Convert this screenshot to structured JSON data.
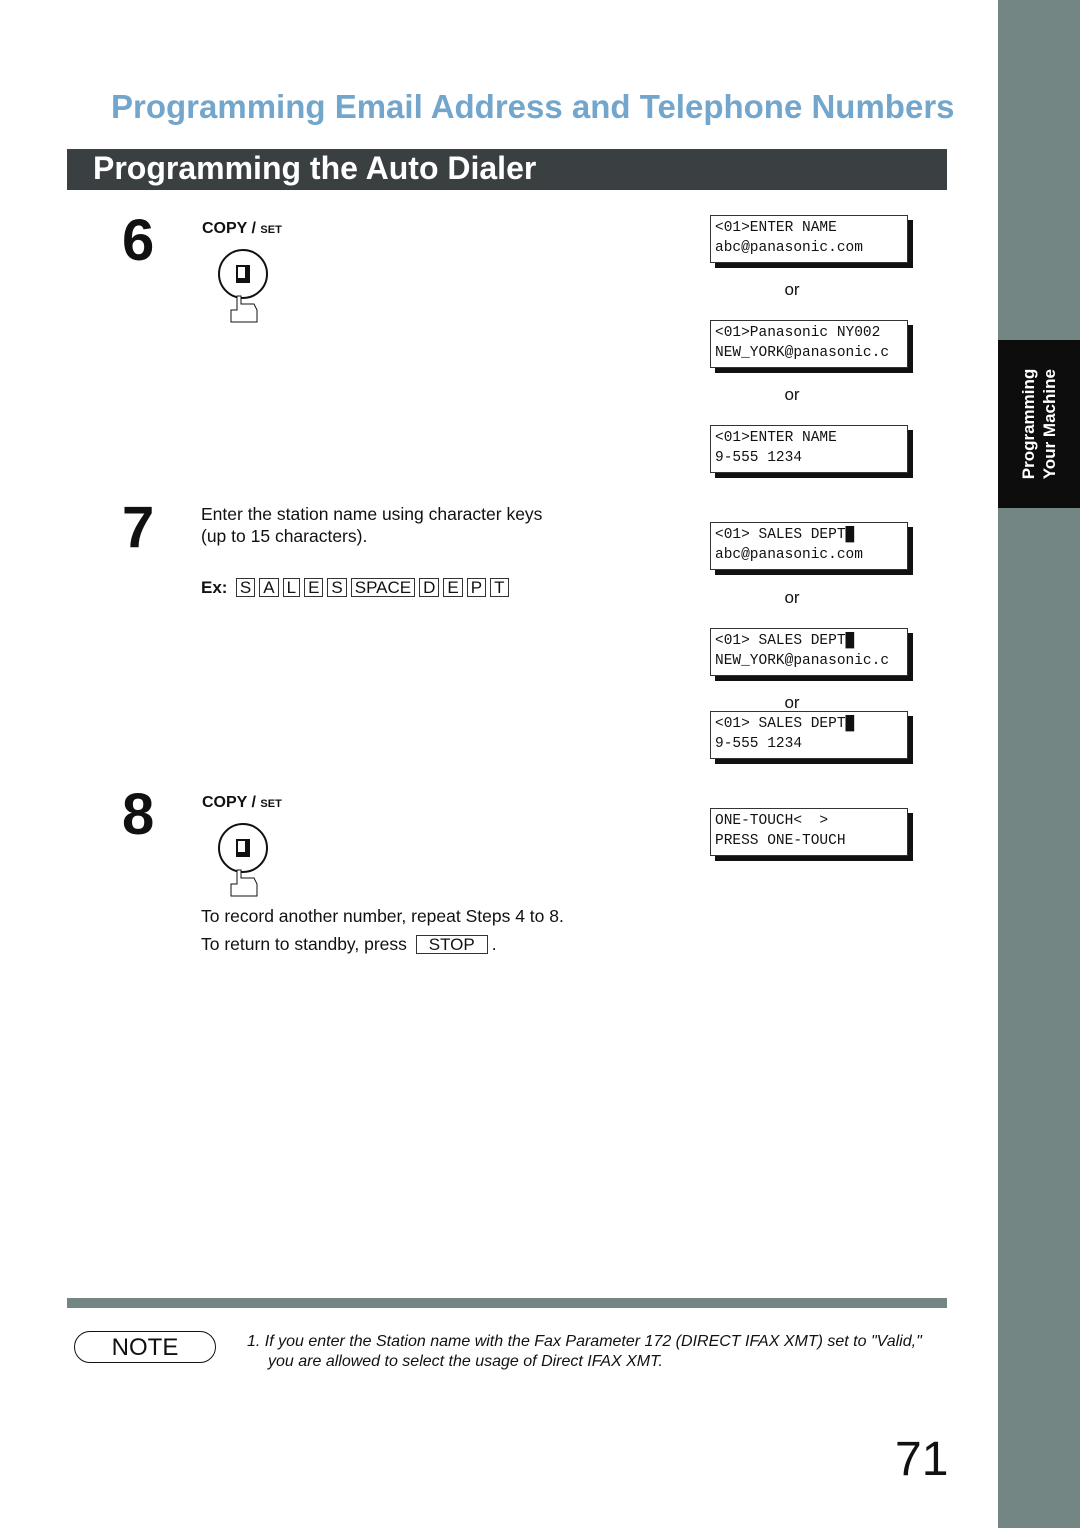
{
  "section_title": "Programming Email Address and Telephone Numbers",
  "header": "Programming the Auto Dialer",
  "side_tab": {
    "line1": "Programming",
    "line2": "Your Machine"
  },
  "steps": [
    {
      "number": "6",
      "key_label": "COPY /",
      "key_label_small": "SET"
    },
    {
      "number": "7",
      "text1": "Enter the station name using character keys",
      "text2": "(up to 15 characters).",
      "ex_label": "Ex:",
      "keys": [
        "S",
        "A",
        "L",
        "E",
        "S",
        "SPACE",
        "D",
        "E",
        "P",
        "T"
      ]
    },
    {
      "number": "8",
      "key_label": "COPY /",
      "key_label_small": "SET",
      "text1": "To record another number, repeat Steps 4 to 8.",
      "text2": "To return to standby, press",
      "stop_key": "STOP",
      "text2_end": "."
    }
  ],
  "displays": [
    {
      "line1": "<01>ENTER NAME",
      "line2": "abc@panasonic.com"
    },
    {
      "line1": "<01>Panasonic NY002",
      "line2": "NEW_YORK@panasonic.c"
    },
    {
      "line1": "<01>ENTER NAME",
      "line2": "9-555 1234"
    },
    {
      "line1": "<01> SALES DEPT█",
      "line2": "abc@panasonic.com"
    },
    {
      "line1": "<01> SALES DEPT█",
      "line2": "NEW_YORK@panasonic.c"
    },
    {
      "line1": "<01> SALES DEPT█",
      "line2": "9-555 1234"
    },
    {
      "line1": "ONE-TOUCH<  >",
      "line2": "PRESS ONE-TOUCH"
    }
  ],
  "or_label": "or",
  "note": {
    "badge": "NOTE",
    "line1": "1.  If you enter the Station name with the Fax Parameter 172 (DIRECT IFAX XMT) set to \"Valid,\"",
    "line2": "you are allowed to select the usage of Direct IFAX XMT."
  },
  "page_number": "71",
  "colors": {
    "title": "#73a6cc",
    "header_bg": "#3a3f42",
    "sidebar": "#748684",
    "tab": "#0d0d0d"
  }
}
